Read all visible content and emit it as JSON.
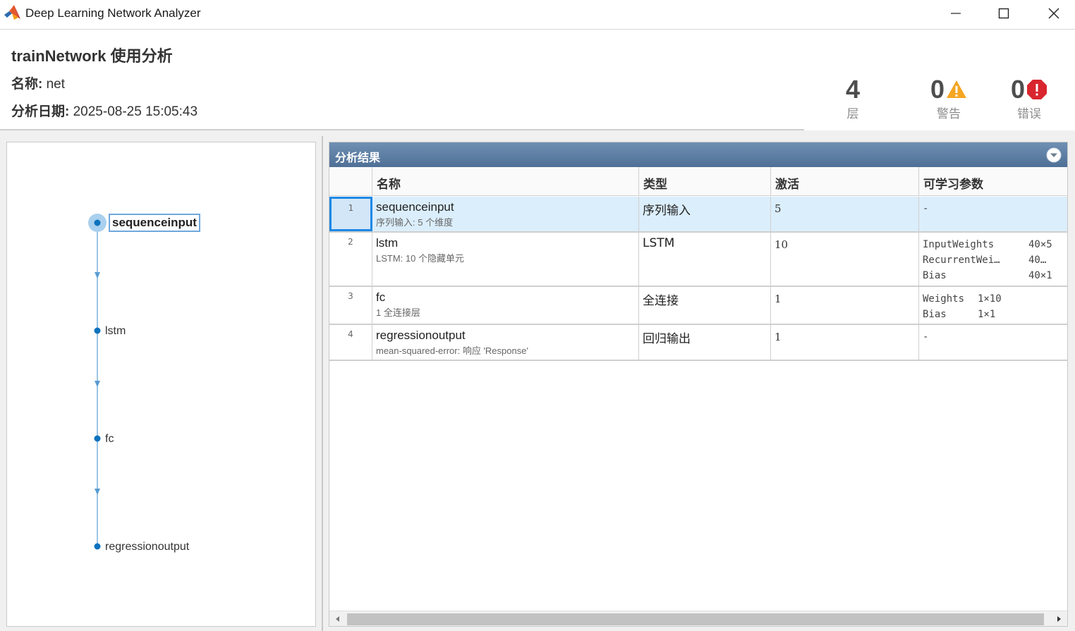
{
  "window": {
    "title": "Deep Learning Network Analyzer",
    "app_icon": "matlab-logo-icon",
    "controls": [
      "minimize-icon",
      "maximize-icon",
      "close-icon"
    ]
  },
  "header": {
    "title": "trainNetwork 使用分析",
    "name_label": "名称:",
    "name_value": "net",
    "date_label": "分析日期:",
    "date_value": "2025-08-25 15:05:43"
  },
  "stats": {
    "layers": {
      "value": "4",
      "label": "层"
    },
    "warnings": {
      "value": "0",
      "label": "警告",
      "icon": "warning-icon",
      "color": "#f5a623"
    },
    "errors": {
      "value": "0",
      "label": "错误",
      "icon": "error-icon",
      "color": "#d9262e"
    }
  },
  "graph": {
    "nodes": [
      {
        "label": "sequenceinput",
        "selected": true
      },
      {
        "label": "lstm",
        "selected": false
      },
      {
        "label": "fc",
        "selected": false
      },
      {
        "label": "regressionoutput",
        "selected": false
      }
    ],
    "accent": "#0e72bd"
  },
  "results": {
    "title": "分析结果",
    "columns": [
      "名称",
      "类型",
      "激活",
      "可学习参数"
    ],
    "rows": [
      {
        "index": "1",
        "name": "sequenceinput",
        "desc": "序列输入: 5 个维度",
        "type": "序列输入",
        "activation": "5",
        "params": [
          {
            "key": "-",
            "value": ""
          }
        ]
      },
      {
        "index": "2",
        "name": "lstm",
        "desc": "LSTM: 10 个隐藏单元",
        "type": "LSTM",
        "activation": "10",
        "params": [
          {
            "key": "InputWeights",
            "value": "40×5"
          },
          {
            "key": "RecurrentWei…",
            "value": "40…"
          },
          {
            "key": "Bias",
            "value": "40×1"
          }
        ]
      },
      {
        "index": "3",
        "name": "fc",
        "desc": "1 全连接层",
        "type": "全连接",
        "activation": "1",
        "params": [
          {
            "key": "Weights",
            "value": "1×10"
          },
          {
            "key": "Bias",
            "value": "1×1"
          }
        ]
      },
      {
        "index": "4",
        "name": "regressionoutput",
        "desc": "mean-squared-error: 响应 'Response'",
        "type": "回归输出",
        "activation": "1",
        "params": [
          {
            "key": "-",
            "value": ""
          }
        ]
      }
    ],
    "selected_row": "1",
    "header_color": "#587aa0",
    "selected_color": "#dbeefb"
  }
}
